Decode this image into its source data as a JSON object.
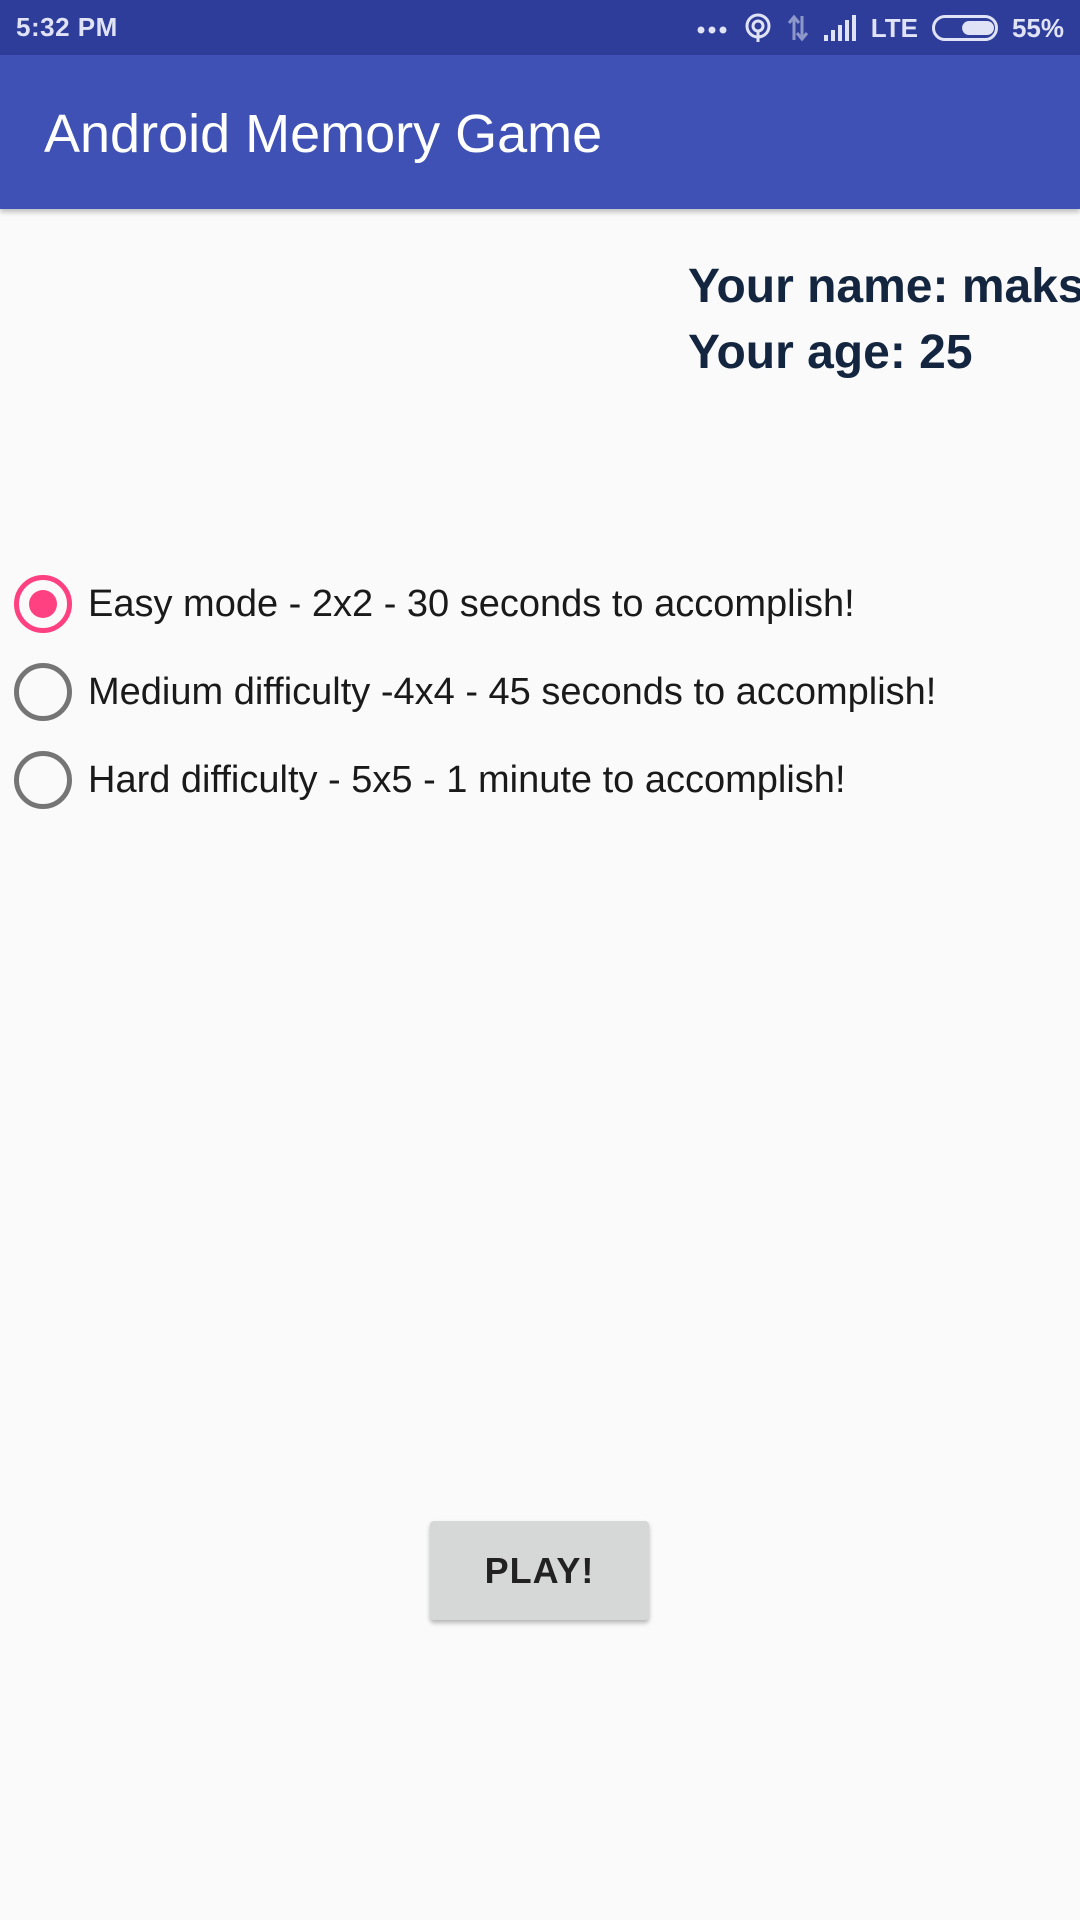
{
  "status_bar": {
    "time": "5:32 PM",
    "network": "LTE",
    "battery": "55%",
    "battery_level": 0.55,
    "icons": [
      "more-dots-icon",
      "hotspot-icon",
      "data-arrows-icon",
      "signal-icon",
      "battery-icon"
    ]
  },
  "app_bar": {
    "title": "Android Memory Game",
    "color": "#3f51b5"
  },
  "user": {
    "name_line": "Your name: maks",
    "age_line": "Your age: 25"
  },
  "difficulty": {
    "selected_index": 0,
    "options": [
      {
        "label": "Easy mode - 2x2 - 30 seconds to accomplish!",
        "checked": true
      },
      {
        "label": "Medium difficulty -4x4 - 45 seconds to accomplish!",
        "checked": false
      },
      {
        "label": "Hard difficulty - 5x5 - 1 minute to accomplish!",
        "checked": false
      }
    ],
    "accent_color": "#ff4081"
  },
  "play_button": {
    "label": "PLAY!"
  }
}
